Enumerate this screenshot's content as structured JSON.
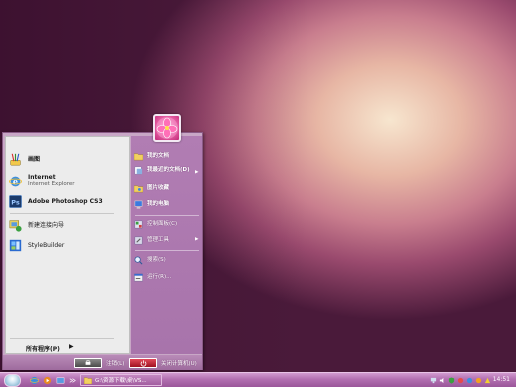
{
  "start_menu": {
    "pinned": [
      {
        "title": "画图",
        "subtitle": "",
        "icon": "paint-icon"
      },
      {
        "title": "Internet",
        "subtitle": "Internet Explorer",
        "icon": "internet-explorer-icon"
      },
      {
        "title": "Adobe Photoshop CS3",
        "subtitle": "",
        "icon": "photoshop-icon"
      }
    ],
    "recent": [
      {
        "title": "新建连接向导",
        "icon": "connection-wizard-icon"
      },
      {
        "title": "StyleBuilder",
        "icon": "stylebuilder-icon"
      }
    ],
    "all_programs": "所有程序(P)",
    "all_programs_arrow": "▶",
    "right_items": [
      {
        "label": "我的文档",
        "icon": "my-documents-icon",
        "has_arrow": false
      },
      {
        "label": "我最近的文档(D)",
        "icon": "recent-documents-icon",
        "has_arrow": true
      },
      {
        "label": "图片收藏",
        "icon": "my-pictures-icon",
        "has_arrow": false
      },
      {
        "label": "我的电脑",
        "icon": "my-computer-icon",
        "has_arrow": false
      },
      {
        "label": "控制面板(C)",
        "icon": "control-panel-icon",
        "has_arrow": false
      },
      {
        "label": "管理工具",
        "icon": "admin-tools-icon",
        "has_arrow": true
      },
      {
        "label": "搜索(S)",
        "icon": "search-icon",
        "has_arrow": false
      },
      {
        "label": "运行(R)...",
        "icon": "run-icon",
        "has_arrow": false
      }
    ],
    "right_arrow": "▶",
    "logoff_label": "注销(L)",
    "shutdown_label": "关闭计算机(U)"
  },
  "taskbar": {
    "task_label": "G:\\资源下载\\桌\\VS...",
    "clock": "14:51"
  },
  "colors": {
    "menu_right_pane": "#b17db3",
    "taskbar": "#b26fb0",
    "shutdown_red": "#c82030"
  }
}
